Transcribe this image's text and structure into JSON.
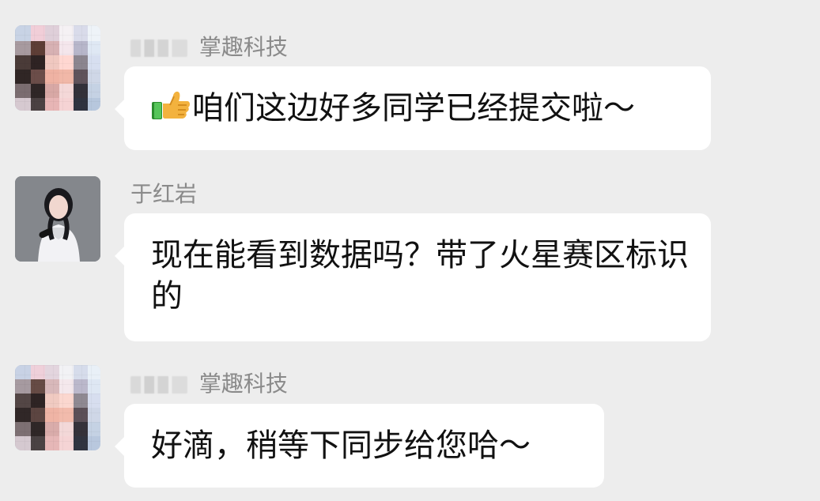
{
  "messages": [
    {
      "sender_visible": "掌趣科技",
      "text": "咱们这边好多同学已经提交啦～",
      "emoji": "thumbs-up-icon"
    },
    {
      "sender_visible": "于红岩",
      "text": "现在能看到数据吗？带了火星赛区标识的"
    },
    {
      "sender_visible": "掌趣科技",
      "text": "好滴，稍等下同步给您哈～"
    }
  ],
  "colors": {
    "background": "#ededed",
    "bubble": "#ffffff",
    "sender": "#8a8a8a",
    "text": "#111111"
  }
}
